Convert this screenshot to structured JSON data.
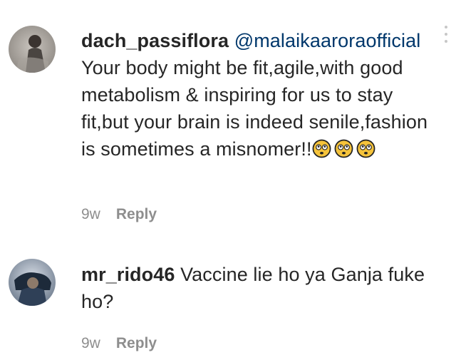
{
  "comments": [
    {
      "username": "dach_passiflora",
      "mention": "@malaikaaroraofficial",
      "text": "Your body might be fit,agile,with good metabolism & inspiring for us to stay fit,but your brain is indeed senile,fashion is sometimes a misnomer!!",
      "emojis": [
        "flushed-face-icon",
        "flushed-face-icon",
        "flushed-face-icon"
      ],
      "time": "9w",
      "reply_label": "Reply"
    },
    {
      "username": "mr_rido46",
      "text": "Vaccine lie ho ya Ganja fuke ho?",
      "time": "9w",
      "reply_label": "Reply"
    }
  ],
  "colors": {
    "text": "#262626",
    "mention": "#00376b",
    "muted": "#8e8e8e",
    "emoji": "#f5c33b"
  }
}
